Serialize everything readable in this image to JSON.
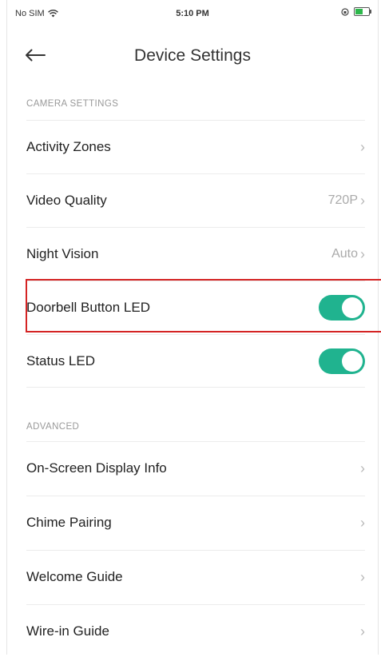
{
  "status_bar": {
    "carrier": "No SIM",
    "time": "5:10 PM"
  },
  "header": {
    "title": "Device Settings"
  },
  "sections": {
    "camera": {
      "title": "CAMERA SETTINGS",
      "items": [
        {
          "label": "Activity Zones"
        },
        {
          "label": "Video Quality",
          "value": "720P"
        },
        {
          "label": "Night Vision",
          "value": "Auto"
        },
        {
          "label": "Doorbell Button LED",
          "toggle": true
        },
        {
          "label": "Status LED",
          "toggle": true
        }
      ]
    },
    "advanced": {
      "title": "ADVANCED",
      "items": [
        {
          "label": "On-Screen Display Info"
        },
        {
          "label": "Chime Pairing"
        },
        {
          "label": "Welcome Guide"
        },
        {
          "label": "Wire-in Guide"
        }
      ]
    }
  },
  "colors": {
    "toggle_on": "#20b38f",
    "highlight_border": "#d42424"
  },
  "icons": {
    "back": "arrow-left-icon",
    "chevron": "chevron-right-icon",
    "wifi": "wifi-icon",
    "battery": "battery-icon"
  },
  "glyphs": {
    "chevron": "›"
  }
}
